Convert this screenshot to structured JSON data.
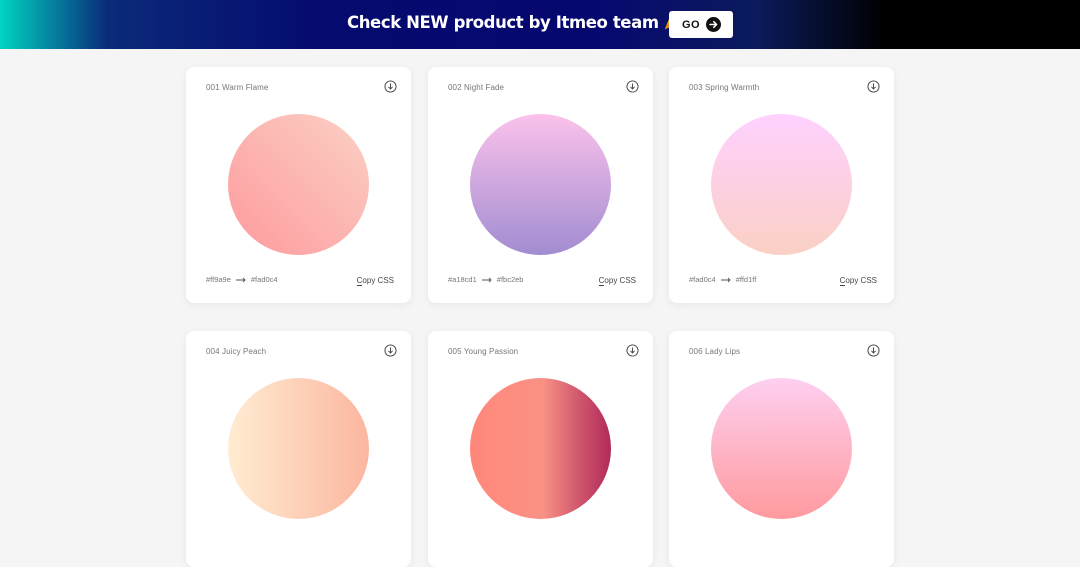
{
  "banner": {
    "text": "Check NEW product by Itmeo team",
    "emoji_icon": "party-popper-icon",
    "go_label": "GO",
    "go_icon": "arrow-right-circle-icon",
    "colors": {
      "gradient_start": "#00d4c2",
      "gradient_mid": "#060870",
      "gradient_end": "#000000"
    }
  },
  "cards": [
    {
      "id": "001",
      "name": "001 Warm Flame",
      "from": "#ff9a9e",
      "to": "#fad0c4",
      "gradient": "linear-gradient(45deg, #ff9a9e 0%, #fad0c4 99%, #fad0c4 100%)",
      "copy_label": "Copy CSS",
      "download_icon": "download-circle-icon"
    },
    {
      "id": "002",
      "name": "002 Night Fade",
      "from": "#a18cd1",
      "to": "#fbc2eb",
      "gradient": "linear-gradient(to top, #a18cd1 0%, #fbc2eb 100%)",
      "copy_label": "Copy CSS",
      "download_icon": "download-circle-icon"
    },
    {
      "id": "003",
      "name": "003 Spring Warmth",
      "from": "#fad0c4",
      "to": "#ffd1ff",
      "gradient": "linear-gradient(to top, #fad0c4 0%, #ffd1ff 100%)",
      "copy_label": "Copy CSS",
      "download_icon": "download-circle-icon"
    },
    {
      "id": "004",
      "name": "004 Juicy Peach",
      "gradient": "linear-gradient(to right, #ffecd2 0%, #fcb69f 100%)",
      "download_icon": "download-circle-icon"
    },
    {
      "id": "005",
      "name": "005 Young Passion",
      "gradient": "linear-gradient(to right, #ff8177 0%, #ff867a 0%, #ff8c7f 21%, #f99185 52%, #cf556c 78%, #b12a5b 100%)",
      "download_icon": "download-circle-icon"
    },
    {
      "id": "006",
      "name": "006 Lady Lips",
      "gradient": "linear-gradient(to top, #ff9a9e 0%, #fecfef 99%, #fecfef 100%)",
      "download_icon": "download-circle-icon"
    }
  ]
}
